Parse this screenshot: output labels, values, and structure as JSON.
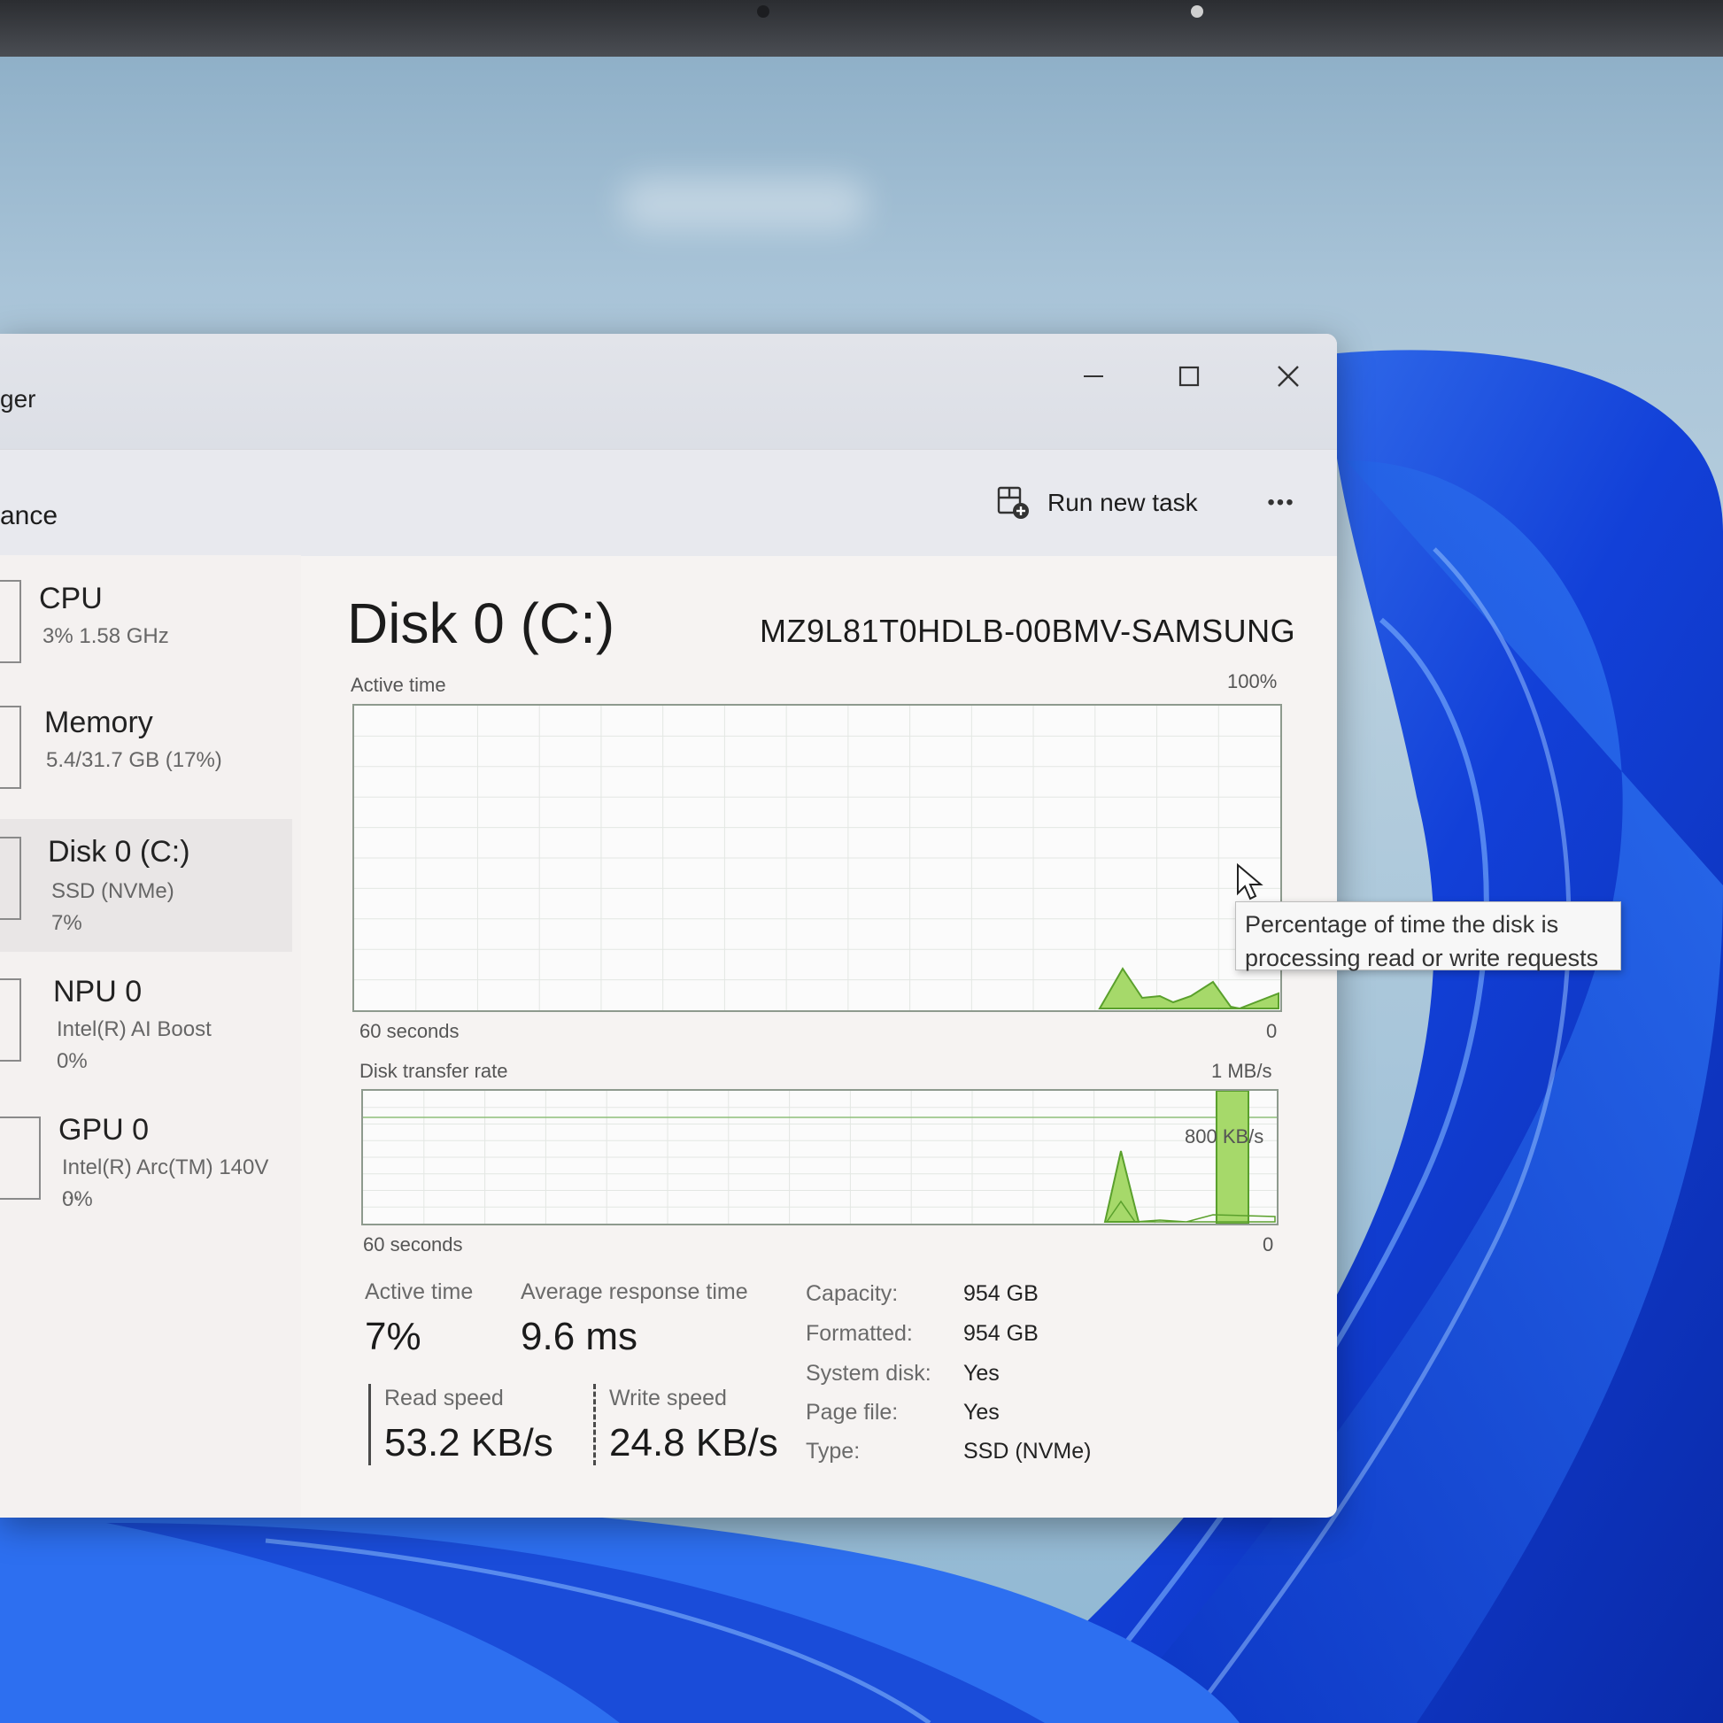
{
  "window": {
    "title_partial": "ger",
    "page_heading_partial": "ance"
  },
  "toolbar": {
    "run_new_task": "Run new task",
    "more": "•••"
  },
  "sidebar": {
    "items": [
      {
        "name": "CPU",
        "line1": "3%  1.58 GHz",
        "line2": ""
      },
      {
        "name": "Memory",
        "line1": "5.4/31.7 GB (17%)",
        "line2": ""
      },
      {
        "name": "Disk 0 (C:)",
        "line1": "SSD (NVMe)",
        "line2": "7%"
      },
      {
        "name": "NPU 0",
        "line1": "Intel(R) AI Boost",
        "line2": "0%"
      },
      {
        "name": "GPU 0",
        "line1": "Intel(R) Arc(TM) 140V ...",
        "line2": "0%"
      }
    ]
  },
  "main": {
    "title": "Disk 0 (C:)",
    "model": "MZ9L81T0HDLB-00BMV-SAMSUNG",
    "active_graph": {
      "label": "Active time",
      "max": "100%",
      "xleft": "60 seconds",
      "xright": "0"
    },
    "transfer_graph": {
      "label": "Disk transfer rate",
      "max": "1 MB/s",
      "mid": "800 KB/s",
      "xleft": "60 seconds",
      "xright": "0"
    },
    "stats": {
      "active_time_label": "Active time",
      "active_time_value": "7%",
      "avg_response_label": "Average response time",
      "avg_response_value": "9.6 ms",
      "read_label": "Read speed",
      "read_value": "53.2 KB/s",
      "write_label": "Write speed",
      "write_value": "24.8 KB/s"
    },
    "properties": [
      {
        "key": "Capacity:",
        "value": "954 GB"
      },
      {
        "key": "Formatted:",
        "value": "954 GB"
      },
      {
        "key": "System disk:",
        "value": "Yes"
      },
      {
        "key": "Page file:",
        "value": "Yes"
      },
      {
        "key": "Type:",
        "value": "SSD (NVMe)"
      }
    ]
  },
  "tooltip": {
    "line1": "Percentage of time the disk is",
    "line2": "processing read or write requests"
  },
  "colors": {
    "graph_fill": "#a6d96a",
    "graph_line": "#5aa02c",
    "window_bg": "#f6f3f2",
    "wallpaper_blue": "#1a4fe0"
  }
}
